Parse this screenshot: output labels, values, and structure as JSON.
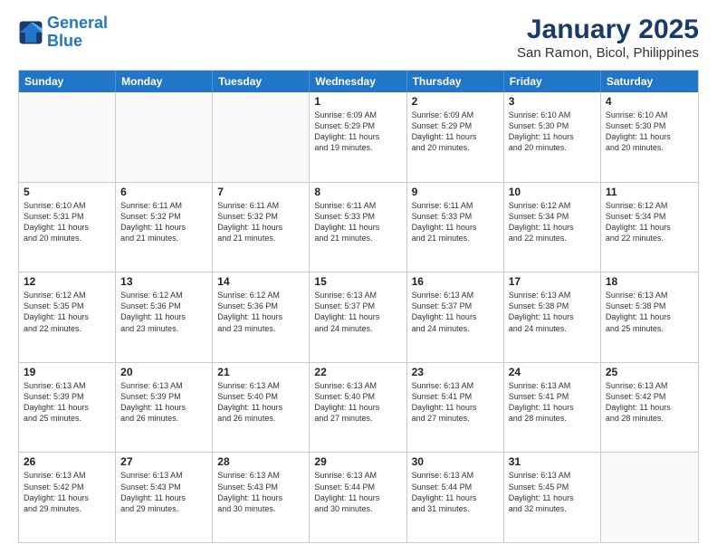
{
  "header": {
    "logo_line1": "General",
    "logo_line2": "Blue",
    "title": "January 2025",
    "subtitle": "San Ramon, Bicol, Philippines"
  },
  "days_of_week": [
    "Sunday",
    "Monday",
    "Tuesday",
    "Wednesday",
    "Thursday",
    "Friday",
    "Saturday"
  ],
  "weeks": [
    [
      {
        "day": "",
        "info": ""
      },
      {
        "day": "",
        "info": ""
      },
      {
        "day": "",
        "info": ""
      },
      {
        "day": "1",
        "info": "Sunrise: 6:09 AM\nSunset: 5:29 PM\nDaylight: 11 hours\nand 19 minutes."
      },
      {
        "day": "2",
        "info": "Sunrise: 6:09 AM\nSunset: 5:29 PM\nDaylight: 11 hours\nand 20 minutes."
      },
      {
        "day": "3",
        "info": "Sunrise: 6:10 AM\nSunset: 5:30 PM\nDaylight: 11 hours\nand 20 minutes."
      },
      {
        "day": "4",
        "info": "Sunrise: 6:10 AM\nSunset: 5:30 PM\nDaylight: 11 hours\nand 20 minutes."
      }
    ],
    [
      {
        "day": "5",
        "info": "Sunrise: 6:10 AM\nSunset: 5:31 PM\nDaylight: 11 hours\nand 20 minutes."
      },
      {
        "day": "6",
        "info": "Sunrise: 6:11 AM\nSunset: 5:32 PM\nDaylight: 11 hours\nand 21 minutes."
      },
      {
        "day": "7",
        "info": "Sunrise: 6:11 AM\nSunset: 5:32 PM\nDaylight: 11 hours\nand 21 minutes."
      },
      {
        "day": "8",
        "info": "Sunrise: 6:11 AM\nSunset: 5:33 PM\nDaylight: 11 hours\nand 21 minutes."
      },
      {
        "day": "9",
        "info": "Sunrise: 6:11 AM\nSunset: 5:33 PM\nDaylight: 11 hours\nand 21 minutes."
      },
      {
        "day": "10",
        "info": "Sunrise: 6:12 AM\nSunset: 5:34 PM\nDaylight: 11 hours\nand 22 minutes."
      },
      {
        "day": "11",
        "info": "Sunrise: 6:12 AM\nSunset: 5:34 PM\nDaylight: 11 hours\nand 22 minutes."
      }
    ],
    [
      {
        "day": "12",
        "info": "Sunrise: 6:12 AM\nSunset: 5:35 PM\nDaylight: 11 hours\nand 22 minutes."
      },
      {
        "day": "13",
        "info": "Sunrise: 6:12 AM\nSunset: 5:36 PM\nDaylight: 11 hours\nand 23 minutes."
      },
      {
        "day": "14",
        "info": "Sunrise: 6:12 AM\nSunset: 5:36 PM\nDaylight: 11 hours\nand 23 minutes."
      },
      {
        "day": "15",
        "info": "Sunrise: 6:13 AM\nSunset: 5:37 PM\nDaylight: 11 hours\nand 24 minutes."
      },
      {
        "day": "16",
        "info": "Sunrise: 6:13 AM\nSunset: 5:37 PM\nDaylight: 11 hours\nand 24 minutes."
      },
      {
        "day": "17",
        "info": "Sunrise: 6:13 AM\nSunset: 5:38 PM\nDaylight: 11 hours\nand 24 minutes."
      },
      {
        "day": "18",
        "info": "Sunrise: 6:13 AM\nSunset: 5:38 PM\nDaylight: 11 hours\nand 25 minutes."
      }
    ],
    [
      {
        "day": "19",
        "info": "Sunrise: 6:13 AM\nSunset: 5:39 PM\nDaylight: 11 hours\nand 25 minutes."
      },
      {
        "day": "20",
        "info": "Sunrise: 6:13 AM\nSunset: 5:39 PM\nDaylight: 11 hours\nand 26 minutes."
      },
      {
        "day": "21",
        "info": "Sunrise: 6:13 AM\nSunset: 5:40 PM\nDaylight: 11 hours\nand 26 minutes."
      },
      {
        "day": "22",
        "info": "Sunrise: 6:13 AM\nSunset: 5:40 PM\nDaylight: 11 hours\nand 27 minutes."
      },
      {
        "day": "23",
        "info": "Sunrise: 6:13 AM\nSunset: 5:41 PM\nDaylight: 11 hours\nand 27 minutes."
      },
      {
        "day": "24",
        "info": "Sunrise: 6:13 AM\nSunset: 5:41 PM\nDaylight: 11 hours\nand 28 minutes."
      },
      {
        "day": "25",
        "info": "Sunrise: 6:13 AM\nSunset: 5:42 PM\nDaylight: 11 hours\nand 28 minutes."
      }
    ],
    [
      {
        "day": "26",
        "info": "Sunrise: 6:13 AM\nSunset: 5:42 PM\nDaylight: 11 hours\nand 29 minutes."
      },
      {
        "day": "27",
        "info": "Sunrise: 6:13 AM\nSunset: 5:43 PM\nDaylight: 11 hours\nand 29 minutes."
      },
      {
        "day": "28",
        "info": "Sunrise: 6:13 AM\nSunset: 5:43 PM\nDaylight: 11 hours\nand 30 minutes."
      },
      {
        "day": "29",
        "info": "Sunrise: 6:13 AM\nSunset: 5:44 PM\nDaylight: 11 hours\nand 30 minutes."
      },
      {
        "day": "30",
        "info": "Sunrise: 6:13 AM\nSunset: 5:44 PM\nDaylight: 11 hours\nand 31 minutes."
      },
      {
        "day": "31",
        "info": "Sunrise: 6:13 AM\nSunset: 5:45 PM\nDaylight: 11 hours\nand 32 minutes."
      },
      {
        "day": "",
        "info": ""
      }
    ]
  ]
}
